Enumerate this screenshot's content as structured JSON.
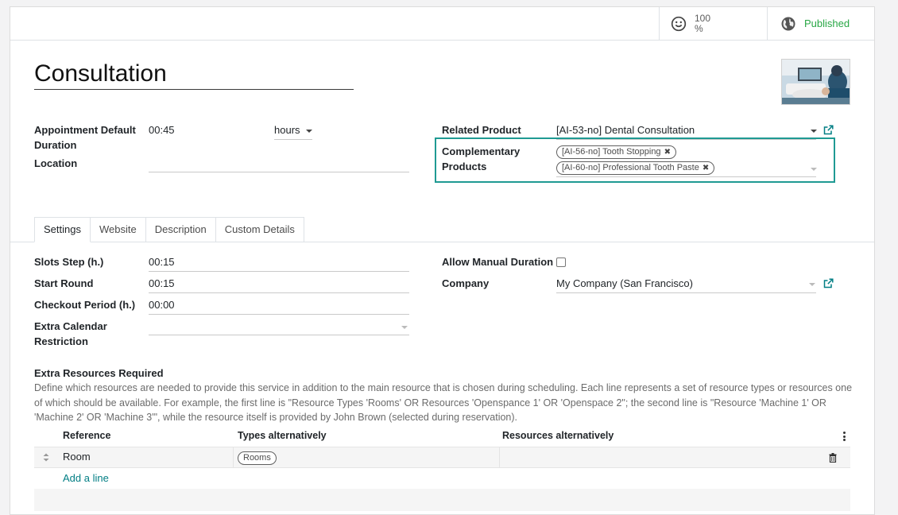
{
  "stat_buttons": {
    "rating": {
      "value": "100",
      "unit": "%",
      "icon": "smile-icon"
    },
    "publish": {
      "label": "Published",
      "icon": "globe-icon"
    }
  },
  "title": "Consultation",
  "fields": {
    "appointment_duration": {
      "label_1": "Appointment Default",
      "label_2": "Duration",
      "value": "00:45",
      "unit": "hours"
    },
    "location": {
      "label": "Location",
      "value": ""
    },
    "related_product": {
      "label": "Related Product",
      "value": "[AI-53-no] Dental Consultation"
    },
    "complementary_products": {
      "label_1": "Complementary",
      "label_2": "Products",
      "tags": [
        "[AI-56-no] Tooth Stopping",
        "[AI-60-no] Professional Tooth Paste"
      ]
    }
  },
  "tabs": [
    "Settings",
    "Website",
    "Description",
    "Custom Details"
  ],
  "settings": {
    "slots_step": {
      "label": "Slots Step (h.)",
      "value": "00:15"
    },
    "start_round": {
      "label": "Start Round",
      "value": "00:15"
    },
    "checkout_period": {
      "label": "Checkout Period (h.)",
      "value": "00:00"
    },
    "extra_calendar": {
      "label_1": "Extra Calendar",
      "label_2": "Restriction",
      "value": ""
    },
    "allow_manual_duration": {
      "label": "Allow Manual Duration",
      "checked": false
    },
    "company": {
      "label": "Company",
      "value": "My Company (San Francisco)"
    }
  },
  "extra_resources": {
    "heading": "Extra Resources Required",
    "description": "Define which resources are needed to provide this service in addition to the main resource that is chosen during scheduling. Each line represents a set of resource types or resources one of which should be available. For example, the first line is \"Resource Types 'Rooms' OR Resources 'Openspance 1' OR 'Openspace 2\"; the second line is \"Resource 'Machine 1' OR 'Machine 2' OR 'Machine 3'\", while the resource itself is provided by John Brown (selected during reservation).",
    "columns": [
      "Reference",
      "Types alternatively",
      "Resources alternatively"
    ],
    "rows": [
      {
        "reference": "Room",
        "types": "Rooms",
        "resources": ""
      }
    ],
    "add_line": "Add a line"
  },
  "colors": {
    "published": "#28a745",
    "accent": "#017e84",
    "highlight": "#1f9a93"
  }
}
